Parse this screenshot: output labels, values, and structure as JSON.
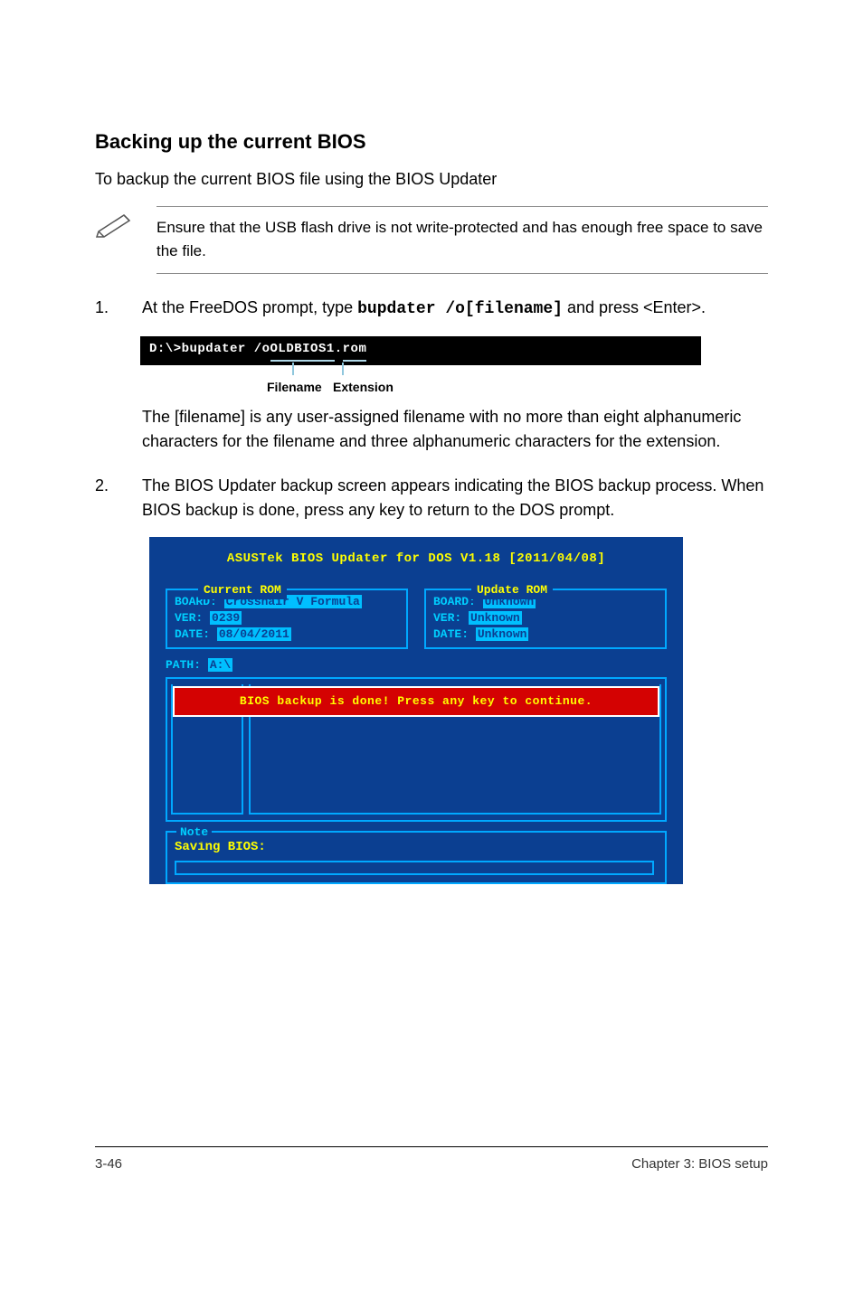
{
  "heading": "Backing up the current BIOS",
  "intro": "To backup the current BIOS file using the BIOS Updater",
  "note": "Ensure that the USB flash drive is not write-protected and has enough free space to save the file.",
  "step1": {
    "num": "1.",
    "text_pre": "At the FreeDOS prompt, type ",
    "code": "bupdater /o[filename]",
    "text_post": " and press <Enter>."
  },
  "terminal": {
    "prompt": "D:\\>bupdater /o",
    "filename": "OLDBIOS1",
    "dot": ".",
    "ext": "rom",
    "label_filename": "Filename",
    "label_extension": "Extension"
  },
  "subtext": "The [filename] is any user-assigned filename with no more than eight alphanumeric characters for the filename and three alphanumeric characters for the extension.",
  "step2": {
    "num": "2.",
    "text": "The BIOS Updater backup screen appears indicating the BIOS backup process. When BIOS backup is done, press any key to return to the DOS prompt."
  },
  "bios": {
    "title": "ASUSTek BIOS Updater for DOS V1.18 [2011/04/08]",
    "current": {
      "legend": "Current ROM",
      "board_label": "BOARD:",
      "board_value": "Crosshair V Formula",
      "ver_label": "VER:",
      "ver_value": "0239",
      "date_label": "DATE:",
      "date_value": "08/04/2011"
    },
    "update": {
      "legend": "Update ROM",
      "board_label": "BOARD:",
      "board_value": "Unknown",
      "ver_label": "VER:",
      "ver_value": "Unknown",
      "date_label": "DATE:",
      "date_value": "Unknown"
    },
    "path_label": "PATH:",
    "path_value": "A:\\",
    "banner": "BIOS backup is done! Press any key to continue.",
    "note_legend": "Note",
    "saving": "Saving BIOS:"
  },
  "footer": {
    "left": "3-46",
    "right": "Chapter 3: BIOS setup"
  }
}
